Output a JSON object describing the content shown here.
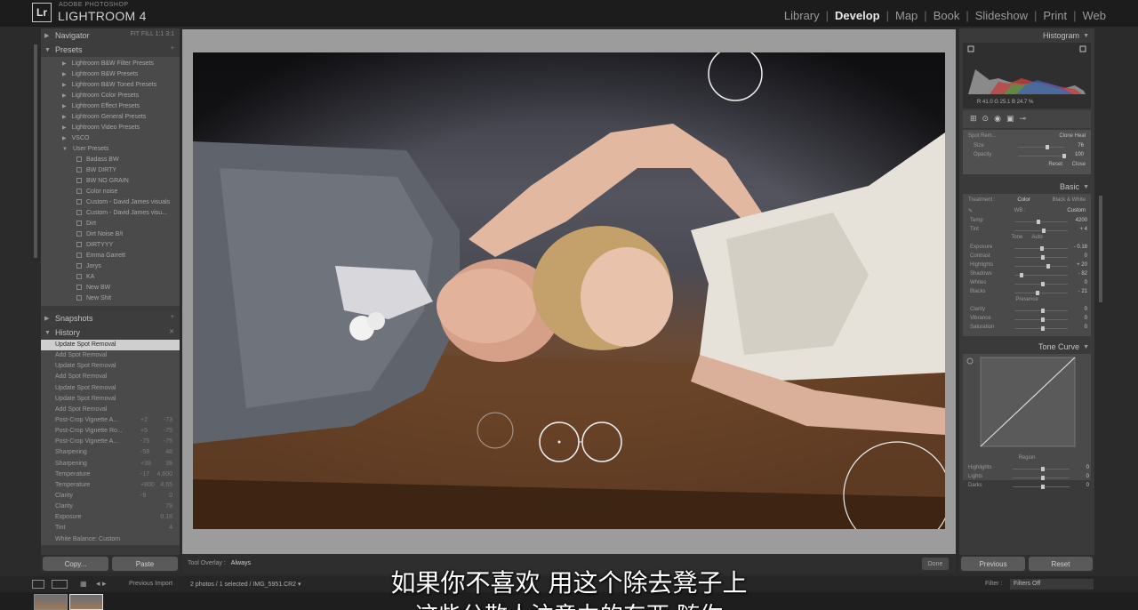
{
  "app": {
    "brand_sub": "ADOBE PHOTOSHOP",
    "brand_main": "LIGHTROOM 4",
    "logo": "Lr",
    "modules": [
      "Library",
      "Develop",
      "Map",
      "Book",
      "Slideshow",
      "Print",
      "Web"
    ],
    "active_module": "Develop"
  },
  "left": {
    "navigator": "Navigator",
    "navigator_zoom": "FIT  FILL  1:1  3:1",
    "presets": "Presets",
    "preset_folders": [
      "Lightroom B&W Filter Presets",
      "Lightroom B&W Presets",
      "Lightroom B&W Toned Presets",
      "Lightroom Color Presets",
      "Lightroom Effect Presets",
      "Lightroom General Presets",
      "Lightroom Video Presets",
      "VSCO",
      "User Presets"
    ],
    "user_presets": [
      "Badass BW",
      "BW DIRTY",
      "BW NO GRAIN",
      "Color noise",
      "Custom - David James visuals",
      "Custom - David James visu...",
      "Dirt",
      "Dirt Noise B/t",
      "DIRTYYY",
      "Emma Garrett",
      "Jorys",
      "KA",
      "New BW",
      "New Shit"
    ],
    "snapshots": "Snapshots",
    "history": "History",
    "history_items": [
      {
        "label": "Update Spot Removal",
        "a": "",
        "b": ""
      },
      {
        "label": "Add Spot Removal",
        "a": "",
        "b": ""
      },
      {
        "label": "Update Spot Removal",
        "a": "",
        "b": ""
      },
      {
        "label": "Add Spot Removal",
        "a": "",
        "b": ""
      },
      {
        "label": "Update Spot Removal",
        "a": "",
        "b": ""
      },
      {
        "label": "Update Spot Removal",
        "a": "",
        "b": ""
      },
      {
        "label": "Add Spot Removal",
        "a": "",
        "b": ""
      },
      {
        "label": "Post-Crop Vignette A...",
        "a": "+2",
        "b": "-73"
      },
      {
        "label": "Post-Crop Vignette Ro...",
        "a": "+5",
        "b": "-75"
      },
      {
        "label": "Post-Crop Vignette A...",
        "a": "-75",
        "b": "-75"
      },
      {
        "label": "Sharpening",
        "a": "-58",
        "b": "48"
      },
      {
        "label": "Sharpening",
        "a": "+38",
        "b": "38"
      },
      {
        "label": "Temperature",
        "a": "-17",
        "b": "4,600"
      },
      {
        "label": "Temperature",
        "a": "+800",
        "b": "4,65"
      },
      {
        "label": "Clarity",
        "a": "-9",
        "b": "0"
      },
      {
        "label": "Clarity",
        "a": "",
        "b": "79"
      },
      {
        "label": "Exposure",
        "a": "",
        "b": "0.18"
      },
      {
        "label": "Tint",
        "a": "",
        "b": "4"
      },
      {
        "label": "White Balance: Custom",
        "a": "",
        "b": ""
      }
    ],
    "copy": "Copy...",
    "paste": "Paste"
  },
  "toolbar": {
    "tool_overlay_label": "Tool Overlay :",
    "tool_overlay_value": "Always",
    "done": "Done"
  },
  "right": {
    "histogram": "Histogram",
    "histo_readout": "R  41.0   G  25.1   B  24.7 %",
    "spot": {
      "title": "Spot Rem...",
      "modes": "Clone    Heal",
      "size_label": "Size",
      "size_value": "76",
      "opacity_label": "Opacity",
      "opacity_value": "100",
      "reset": "Reset",
      "close": "Close"
    },
    "basic": "Basic",
    "treatment": "Treatment :",
    "color": "Color",
    "bw": "Black & White",
    "wb_label": "WB :",
    "wb_value": "Custom",
    "tone": "Tone",
    "auto": "Auto",
    "presence": "Presence",
    "sliders": [
      {
        "name": "Temp",
        "value": "4200",
        "pos": 0.42
      },
      {
        "name": "Tint",
        "value": "+ 4",
        "pos": 0.52
      },
      {
        "name": "Exposure",
        "value": "- 0.18",
        "pos": 0.48
      },
      {
        "name": "Contrast",
        "value": "0",
        "pos": 0.5
      },
      {
        "name": "Highlights",
        "value": "+ 20",
        "pos": 0.6
      },
      {
        "name": "Shadows",
        "value": "- 82",
        "pos": 0.1
      },
      {
        "name": "Whites",
        "value": "0",
        "pos": 0.5
      },
      {
        "name": "Blacks",
        "value": "- 21",
        "pos": 0.4
      },
      {
        "name": "Clarity",
        "value": "0",
        "pos": 0.5
      },
      {
        "name": "Vibrance",
        "value": "0",
        "pos": 0.5
      },
      {
        "name": "Saturation",
        "value": "0",
        "pos": 0.5
      }
    ],
    "tone_curve": "Tone Curve",
    "region": "Region",
    "curve_rows": [
      {
        "name": "Highlights",
        "value": "0"
      },
      {
        "name": "Lights",
        "value": "0"
      },
      {
        "name": "Darks",
        "value": "0"
      }
    ],
    "previous": "Previous",
    "reset": "Reset"
  },
  "filmbar": {
    "previous_import": "Previous Import",
    "info": "2 photos / 1 selected / IMG_5951.CR2 ▾",
    "filter_label": "Filter :",
    "filter_value": "Filters Off"
  },
  "subtitles": {
    "line1": "如果你不喜欢 用这个除去凳子上",
    "line2": "这些分散人注意力的东西 随你"
  },
  "colors": {
    "accent": "#e8e8e8",
    "panel": "#3a3a3a"
  }
}
